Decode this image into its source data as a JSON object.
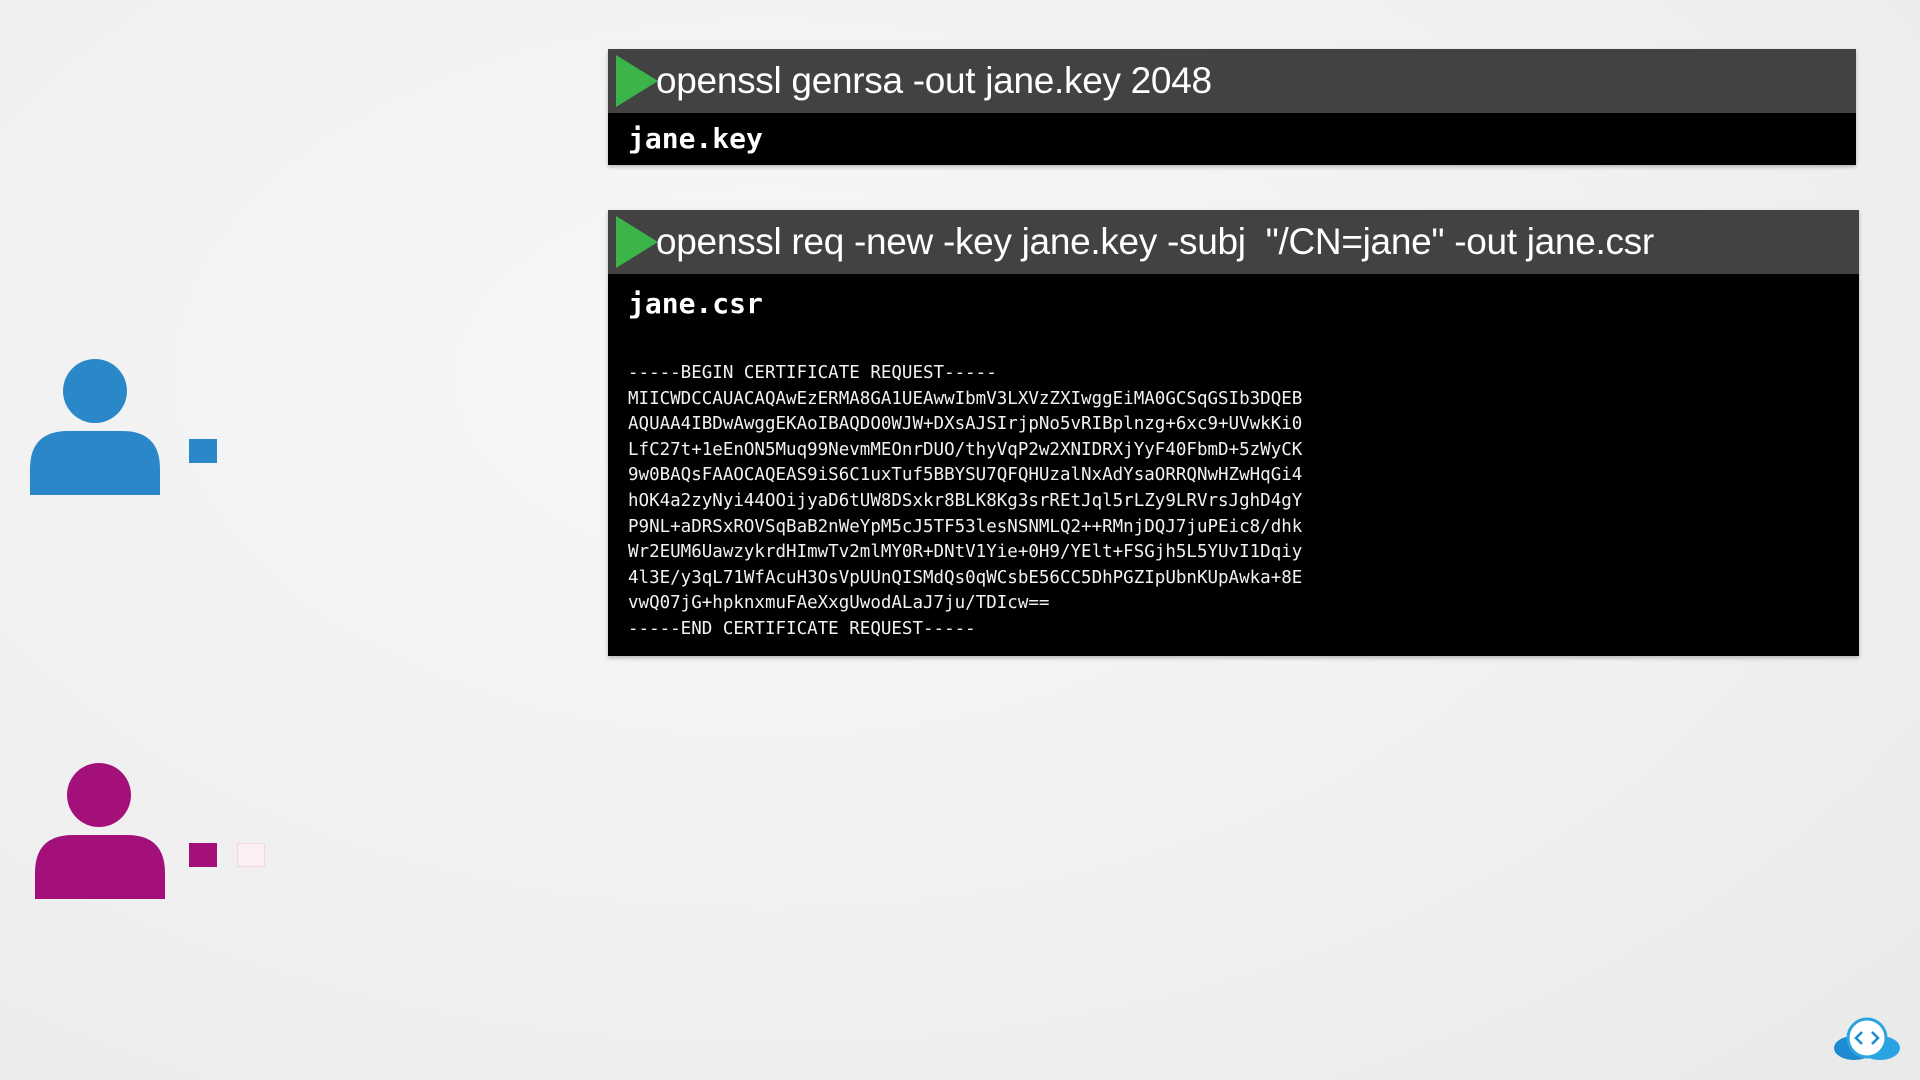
{
  "commands": [
    {
      "command": "openssl genrsa -out jane.key 2048",
      "output_file": "jane.key"
    },
    {
      "command": "openssl req -new -key jane.key -subj  \"/CN=jane\" -out jane.csr",
      "output_file": "jane.csr",
      "certificate_request": [
        "-----BEGIN CERTIFICATE REQUEST-----",
        "MIICWDCCAUACAQAwEzERMA8GA1UEAwwIbmV3LXVzZXIwggEiMA0GCSqGSIb3DQEB",
        "AQUAA4IBDwAwggEKAoIBAQDO0WJW+DXsAJSIrjpNo5vRIBplnzg+6xc9+UVwkKi0",
        "LfC27t+1eEnON5Muq99NevmMEOnrDUO/thyVqP2w2XNIDRXjYyF40FbmD+5zWyCK",
        "9w0BAQsFAAOCAQEAS9iS6C1uxTuf5BBYSU7QFQHUzalNxAdYsaORRQNwHZwHqGi4",
        "hOK4a2zyNyi44OOijyaD6tUW8DSxkr8BLK8Kg3srREtJql5rLZy9LRVrsJghD4gY",
        "P9NL+aDRSxROVSqBaB2nWeYpM5cJ5TF53lesNSNMLQ2++RMnjDQJ7juPEic8/dhk",
        "Wr2EUM6UawzykrdHImwTv2mlMY0R+DNtV1Yie+0H9/YElt+FSGjh5L5YUvI1Dqiy",
        "4l3E/y3qL71WfAcuH3OsVpUUnQISMdQs0qWCsbE56CC5DhPGZIpUbnKUpAwka+8E",
        "vwQ07jG+hpknxmuFAeXxgUwodALaJ7ju/TDIcw==",
        "-----END CERTIFICATE REQUEST-----"
      ]
    }
  ],
  "colors": {
    "play_green": "#3bb54a",
    "user_blue": "#2b88c8",
    "user_magenta": "#a3107a",
    "command_bar": "#424242"
  },
  "users": [
    {
      "icon": "person-icon",
      "color": "blue",
      "keys": 1
    },
    {
      "icon": "person-icon",
      "color": "magenta",
      "keys": 2
    }
  ],
  "logo": {
    "icon": "cloud-code-logo"
  }
}
